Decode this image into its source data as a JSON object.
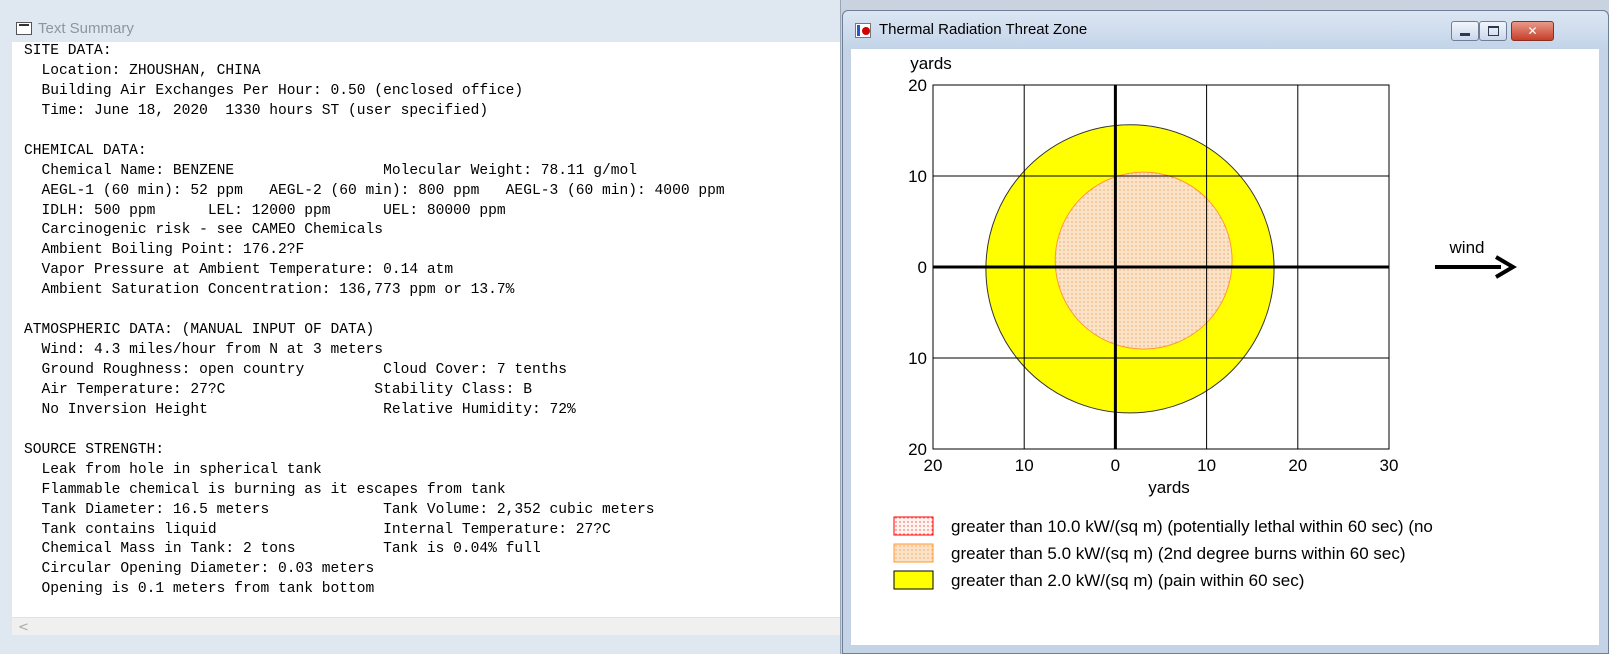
{
  "text_window": {
    "title": "Text Summary",
    "lines": [
      "SITE DATA:",
      "  Location: ZHOUSHAN, CHINA",
      "  Building Air Exchanges Per Hour: 0.50 (enclosed office)",
      "  Time: June 18, 2020  1330 hours ST (user specified)",
      "",
      "CHEMICAL DATA:",
      "  Chemical Name: BENZENE                 Molecular Weight: 78.11 g/mol",
      "  AEGL-1 (60 min): 52 ppm   AEGL-2 (60 min): 800 ppm   AEGL-3 (60 min): 4000 ppm",
      "  IDLH: 500 ppm      LEL: 12000 ppm      UEL: 80000 ppm",
      "  Carcinogenic risk - see CAMEO Chemicals",
      "  Ambient Boiling Point: 176.2?F",
      "  Vapor Pressure at Ambient Temperature: 0.14 atm",
      "  Ambient Saturation Concentration: 136,773 ppm or 13.7%",
      "",
      "ATMOSPHERIC DATA: (MANUAL INPUT OF DATA)",
      "  Wind: 4.3 miles/hour from N at 3 meters",
      "  Ground Roughness: open country         Cloud Cover: 7 tenths",
      "  Air Temperature: 27?C                 Stability Class: B",
      "  No Inversion Height                    Relative Humidity: 72%",
      "",
      "SOURCE STRENGTH:",
      "  Leak from hole in spherical tank",
      "  Flammable chemical is burning as it escapes from tank",
      "  Tank Diameter: 16.5 meters             Tank Volume: 2,352 cubic meters",
      "  Tank contains liquid                   Internal Temperature: 27?C",
      "  Chemical Mass in Tank: 2 tons          Tank is 0.04% full",
      "  Circular Opening Diameter: 0.03 meters",
      "  Opening is 0.1 meters from tank bottom"
    ],
    "scroll_left_glyph": "<"
  },
  "threat_window": {
    "title": "Thermal Radiation Threat Zone",
    "minimize_icon": "minimize-icon",
    "maximize_icon": "maximize-icon",
    "close_icon": "close-icon",
    "close_glyph": "✕",
    "wind_label": "wind",
    "colors": {
      "red_zone_stroke": "#ff0000",
      "orange_zone_fill": "#fbe3c8",
      "orange_zone_stroke": "#ff9933",
      "yellow_zone_fill": "#ffff00",
      "axis": "#000000"
    }
  },
  "chart_data": {
    "type": "scatter",
    "title": "",
    "xlabel": "yards",
    "ylabel": "yards",
    "xlim": [
      -20,
      30
    ],
    "ylim": [
      -20,
      20
    ],
    "x_ticks": [
      -20,
      -10,
      0,
      10,
      20,
      30
    ],
    "x_tick_labels": [
      "20",
      "10",
      "0",
      "10",
      "20",
      "30"
    ],
    "y_ticks": [
      20,
      10,
      0,
      -10,
      -20
    ],
    "y_tick_labels": [
      "20",
      "10",
      "0",
      "10",
      "20"
    ],
    "grid": true,
    "zones": [
      {
        "name": "greater than 2.0 kW/(sq m) (pain within 60 sec)",
        "center_x": 1.6,
        "center_y": -0.2,
        "radius": 15.8,
        "color": "#ffff00"
      },
      {
        "name": "greater than 5.0 kW/(sq m) (2nd degree burns within 60 sec)",
        "center_x": 3.1,
        "center_y": 0.7,
        "radius": 9.7,
        "color": "#fbe3c8"
      }
    ],
    "legend": [
      {
        "label": "greater than 10.0 kW/(sq m) (potentially lethal within 60 sec) (no",
        "swatch": "red-dotted"
      },
      {
        "label": "greater than 5.0 kW/(sq m) (2nd degree burns within 60 sec)",
        "swatch": "orange-dotted"
      },
      {
        "label": "greater than 2.0 kW/(sq m) (pain within 60 sec)",
        "swatch": "yellow-solid"
      }
    ]
  }
}
